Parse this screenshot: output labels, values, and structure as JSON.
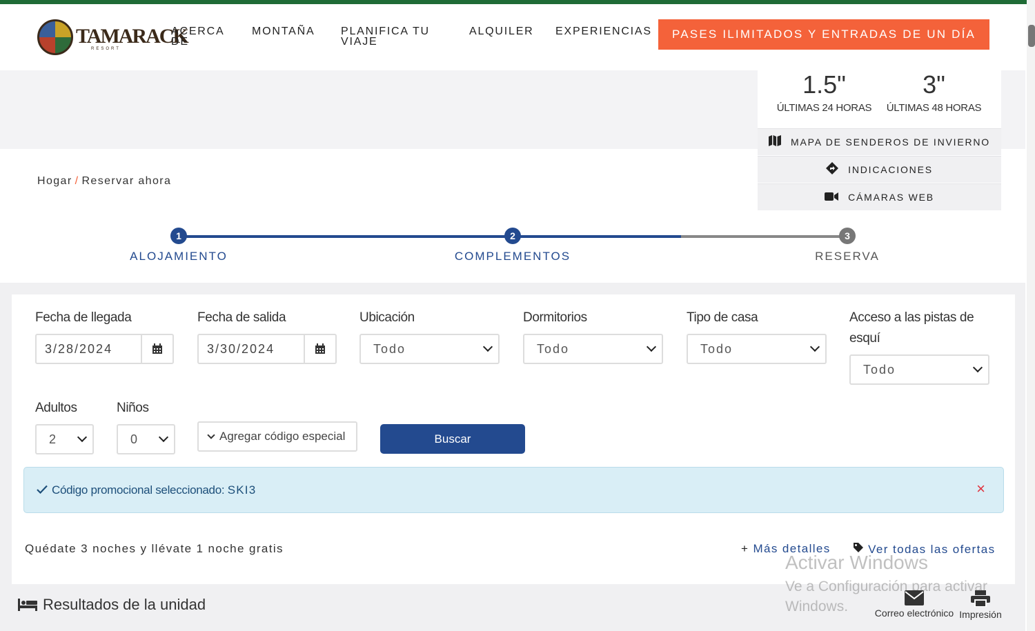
{
  "brand": {
    "logo_text": "TAMARACK",
    "logo_sub": "RESORT"
  },
  "nav": {
    "items": [
      "ACERCA DE",
      "MONTAÑA",
      "PLANIFICA TU VIAJE",
      "ALQUILER",
      "EXPERIENCIAS"
    ],
    "cta": "PASES ILIMITADOS Y ENTRADAS DE UN DÍA"
  },
  "snow_report": {
    "stats": [
      {
        "value": "1.5\"",
        "label": "ÚLTIMAS 24 HORAS"
      },
      {
        "value": "3\"",
        "label": "ÚLTIMAS 48 HORAS"
      }
    ],
    "links": [
      {
        "label": "MAPA DE SENDEROS DE INVIERNO",
        "icon": "map-icon"
      },
      {
        "label": "INDICACIONES",
        "icon": "directions-icon"
      },
      {
        "label": "CÁMARAS WEB",
        "icon": "camera-icon"
      }
    ]
  },
  "breadcrumb": {
    "home": "Hogar",
    "separator": "/",
    "current": "Reservar ahora"
  },
  "steps": [
    {
      "number": "1",
      "label": "ALOJAMIENTO",
      "state": "done"
    },
    {
      "number": "2",
      "label": "COMPLEMENTOS",
      "state": "active"
    },
    {
      "number": "3",
      "label": "RESERVA",
      "state": "pending"
    }
  ],
  "form": {
    "arrival_label": "Fecha de llegada",
    "arrival_value": "3/28/2024",
    "departure_label": "Fecha de salida",
    "departure_value": "3/30/2024",
    "location_label": "Ubicación",
    "location_value": "Todo",
    "bedrooms_label": "Dormitorios",
    "bedrooms_value": "Todo",
    "house_type_label": "Tipo de casa",
    "house_type_value": "Todo",
    "ski_access_label": "Acceso a las pistas de esquí",
    "ski_access_value": "Todo",
    "adults_label": "Adultos",
    "adults_value": "2",
    "children_label": "Niños",
    "children_value": "0",
    "promo_toggle": "Agregar código especial",
    "search_button": "Buscar"
  },
  "alert": {
    "prefix": "Código promocional seleccionado:",
    "code": "SKI3",
    "close": "×"
  },
  "offer": {
    "text": "Quédate 3 noches y llévate 1 noche gratis",
    "details": "Más detalles",
    "all_offers": "Ver todas las ofertas"
  },
  "results": {
    "title": "Resultados de la unidad",
    "email": "Correo electrónico",
    "print": "Impresión"
  },
  "watermark": {
    "title": "Activar Windows",
    "subtitle": "Ve a Configuración para activar Windows."
  },
  "colors": {
    "accent": "#f4623a",
    "primary": "#234a8f",
    "brand_green": "#1f6b36",
    "alert_bg": "#d9eef6"
  }
}
